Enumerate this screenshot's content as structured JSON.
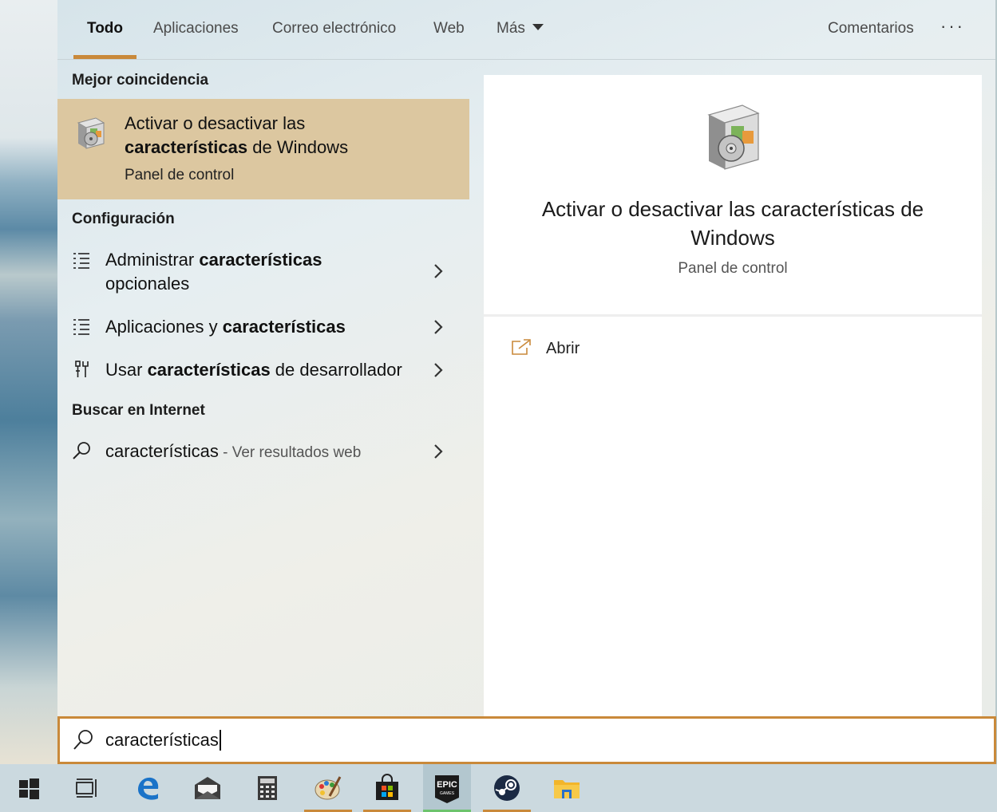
{
  "tabs": [
    {
      "label": "Todo",
      "active": true
    },
    {
      "label": "Aplicaciones"
    },
    {
      "label": "Correo electrónico"
    },
    {
      "label": "Web"
    },
    {
      "label": "Más"
    }
  ],
  "header_right": {
    "feedback": "Comentarios",
    "more": "···"
  },
  "sections": {
    "best_match": "Mejor coincidencia",
    "settings": "Configuración",
    "web": "Buscar en Internet"
  },
  "best_match": {
    "title_line1": "Activar o desactivar las",
    "title_bold": "características",
    "title_rest": " de Windows",
    "subtitle": "Panel de control",
    "icon": "windows-features-icon"
  },
  "settings_items": [
    {
      "pre": "Administrar ",
      "bold": "características",
      "post": "",
      "line2": "opcionales",
      "icon": "list-settings-icon"
    },
    {
      "pre": "Aplicaciones y ",
      "bold": "características",
      "post": "",
      "icon": "list-settings-icon"
    },
    {
      "pre": "Usar ",
      "bold": "características",
      "post": " de desarrollador",
      "icon": "developer-tools-icon"
    }
  ],
  "web_item": {
    "query": "características",
    "suffix": " - Ver resultados web",
    "icon": "search-icon"
  },
  "preview": {
    "title": "Activar o desactivar las características de Windows",
    "subtitle": "Panel de control",
    "open_label": "Abrir",
    "icon": "windows-features-icon"
  },
  "search": {
    "value": "características",
    "icon": "search-icon"
  },
  "taskbar": [
    {
      "name": "start-windows-icon"
    },
    {
      "name": "task-view-icon"
    },
    {
      "name": "edge-browser-icon"
    },
    {
      "name": "mail-icon"
    },
    {
      "name": "calculator-icon"
    },
    {
      "name": "paint-icon",
      "running": true
    },
    {
      "name": "microsoft-store-icon",
      "running": true
    },
    {
      "name": "epic-games-icon",
      "running": true,
      "active": true,
      "text": "EPIC",
      "subtext": "GAMES"
    },
    {
      "name": "steam-icon",
      "running": true
    },
    {
      "name": "file-explorer-icon"
    }
  ],
  "colors": {
    "accent": "#c9893a",
    "highlight": "#dcc7a0",
    "taskbar": "#cbd9df",
    "epic_indicator": "#6cc36c"
  }
}
